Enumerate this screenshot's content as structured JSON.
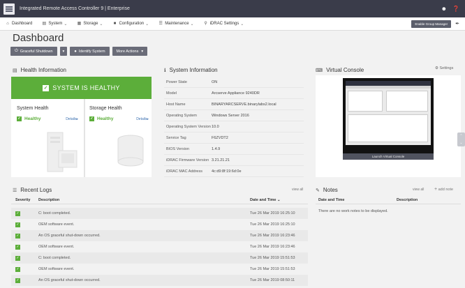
{
  "app": {
    "title": "Integrated Remote Access Controller 9 | Enterprise",
    "user_icon": "user-icon",
    "help_icon": "help-icon"
  },
  "nav": {
    "items": [
      {
        "label": "Dashboard",
        "icon": "home-icon"
      },
      {
        "label": "System",
        "icon": "system-icon"
      },
      {
        "label": "Storage",
        "icon": "storage-icon"
      },
      {
        "label": "Configuration",
        "icon": "configuration-icon"
      },
      {
        "label": "Maintenance",
        "icon": "maintenance-icon"
      },
      {
        "label": "iDRAC Settings",
        "icon": "key-icon"
      }
    ],
    "group_manager_button": "Enable Group Manager"
  },
  "page": {
    "title": "Dashboard"
  },
  "actions": {
    "graceful_shutdown": "Graceful Shutdown",
    "identify_system": "Identify System",
    "more_actions": "More Actions"
  },
  "health": {
    "title": "Health Information",
    "banner": "SYSTEM IS HEALTHY",
    "system": {
      "title": "System Health",
      "status": "Healthy",
      "details": "Details"
    },
    "storage": {
      "title": "Storage Health",
      "status": "Healthy",
      "details": "Details"
    },
    "status_color": "#5cae3a"
  },
  "sysinfo": {
    "title": "System Information",
    "rows": [
      {
        "label": "Power State",
        "value": "ON"
      },
      {
        "label": "Model",
        "value": "Arcserve Appliance 9240DR"
      },
      {
        "label": "Host Name",
        "value": "BINARYARCSERVE.binarylabs2.local"
      },
      {
        "label": "Operating System",
        "value": "Windows Server 2016"
      },
      {
        "label": "Operating System Version",
        "value": "10.0"
      },
      {
        "label": "Service Tag",
        "value": "F6ZVDT2"
      },
      {
        "label": "BIOS Version",
        "value": "1.4.9"
      },
      {
        "label": "iDRAC Firmware Version",
        "value": "3.21.21.21"
      },
      {
        "label": "iDRAC MAC Address",
        "value": "4c:d9:8f:19:6d:0e"
      }
    ]
  },
  "console": {
    "title": "Virtual Console",
    "settings": "Settings",
    "launch": "Launch Virtual Console"
  },
  "logs": {
    "title": "Recent Logs",
    "view_all": "view all",
    "headers": {
      "severity": "Severity",
      "description": "Description",
      "date": "Date and Time"
    },
    "rows": [
      {
        "description": "C: boot completed.",
        "date": "Tue 26 Mar 2019 16:25:10"
      },
      {
        "description": "OEM software event.",
        "date": "Tue 26 Mar 2019 16:25:10"
      },
      {
        "description": "An OS graceful shut-down occurred.",
        "date": "Tue 26 Mar 2019 16:23:46"
      },
      {
        "description": "OEM software event.",
        "date": "Tue 26 Mar 2019 16:23:46"
      },
      {
        "description": "C: boot completed.",
        "date": "Tue 26 Mar 2019 15:51:53"
      },
      {
        "description": "OEM software event.",
        "date": "Tue 26 Mar 2019 15:51:53"
      },
      {
        "description": "An OS graceful shut-down occurred.",
        "date": "Tue 26 Mar 2019 08:50:11"
      }
    ]
  },
  "notes": {
    "title": "Notes",
    "view_all": "view all",
    "add_note": "add note",
    "headers": {
      "date": "Date and Time",
      "description": "Description"
    },
    "empty": "There are no work notes to be displayed."
  }
}
